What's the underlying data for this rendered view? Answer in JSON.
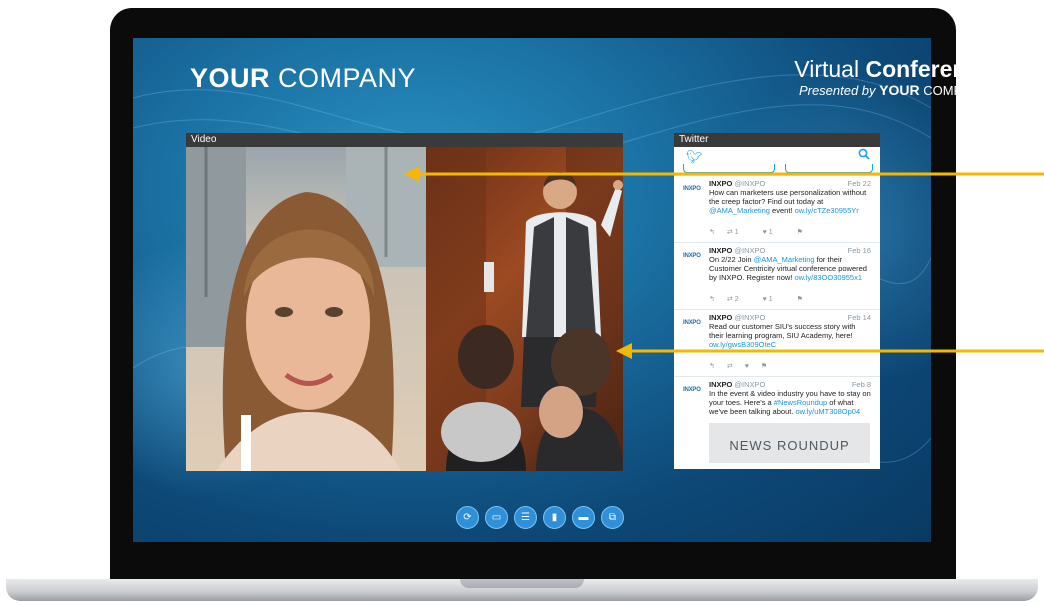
{
  "brand": {
    "bold": "YOUR",
    "rest": " COMPANY"
  },
  "conference": {
    "title_light": "Virtual ",
    "title_bold": "Conference",
    "presented_by": "Presented by ",
    "presenter_bold": "YOUR",
    "presenter_rest": " COMPANY"
  },
  "video_panel": {
    "title": "Video"
  },
  "twitter_panel": {
    "title": "Twitter",
    "tweets": [
      {
        "account": "INXPO",
        "handle": "@INXPO",
        "date": "Feb 22",
        "text": "How can marketers use personalization without the creep factor? Find out today at ",
        "link1": "@AMA_Marketing",
        "text2": " event! ",
        "link2": "ow.ly/cTZe30955Yr",
        "retweets": "1",
        "likes": "1"
      },
      {
        "account": "INXPO",
        "handle": "@INXPO",
        "date": "Feb 16",
        "text": "On 2/22 Join ",
        "link1": "@AMA_Marketing",
        "text2": " for their Customer Centricity virtual conference powered by INXPO. Register now! ",
        "link2": "ow.ly/83OO30955x1",
        "retweets": "2",
        "likes": "1"
      },
      {
        "account": "INXPO",
        "handle": "@INXPO",
        "date": "Feb 14",
        "text": "Read our customer SIU's success story with their learning program, SIU Academy, here! ",
        "link1": "",
        "text2": "",
        "link2": "ow.ly/gwsB309OteC",
        "retweets": "",
        "likes": ""
      },
      {
        "account": "INXPO",
        "handle": "@INXPO",
        "date": "Feb 8",
        "text": "In the event & video industry you have to stay on your toes. Here's a ",
        "link1": "#NewsRoundup",
        "text2": " of what we've been talking about. ",
        "link2": "ow.ly/uMT308Op04",
        "retweets": "",
        "likes": ""
      }
    ],
    "news_card": "NEWS ROUNDUP"
  },
  "toolbar": {
    "tools": [
      {
        "icon": "refresh-icon",
        "glyph": "⟳"
      },
      {
        "icon": "presentation-icon",
        "glyph": "▭"
      },
      {
        "icon": "agenda-icon",
        "glyph": "☰"
      },
      {
        "icon": "document-icon",
        "glyph": "▮"
      },
      {
        "icon": "chat-icon",
        "glyph": "▬"
      },
      {
        "icon": "qa-icon",
        "glyph": "⧉"
      }
    ]
  },
  "colors": {
    "screen_bg": "#0d4877",
    "accent_blue": "#2f8fd8",
    "twitter_blue": "#1da1f2",
    "arrow_yellow": "#f5b800",
    "panel_header": "#3a3a3a"
  }
}
